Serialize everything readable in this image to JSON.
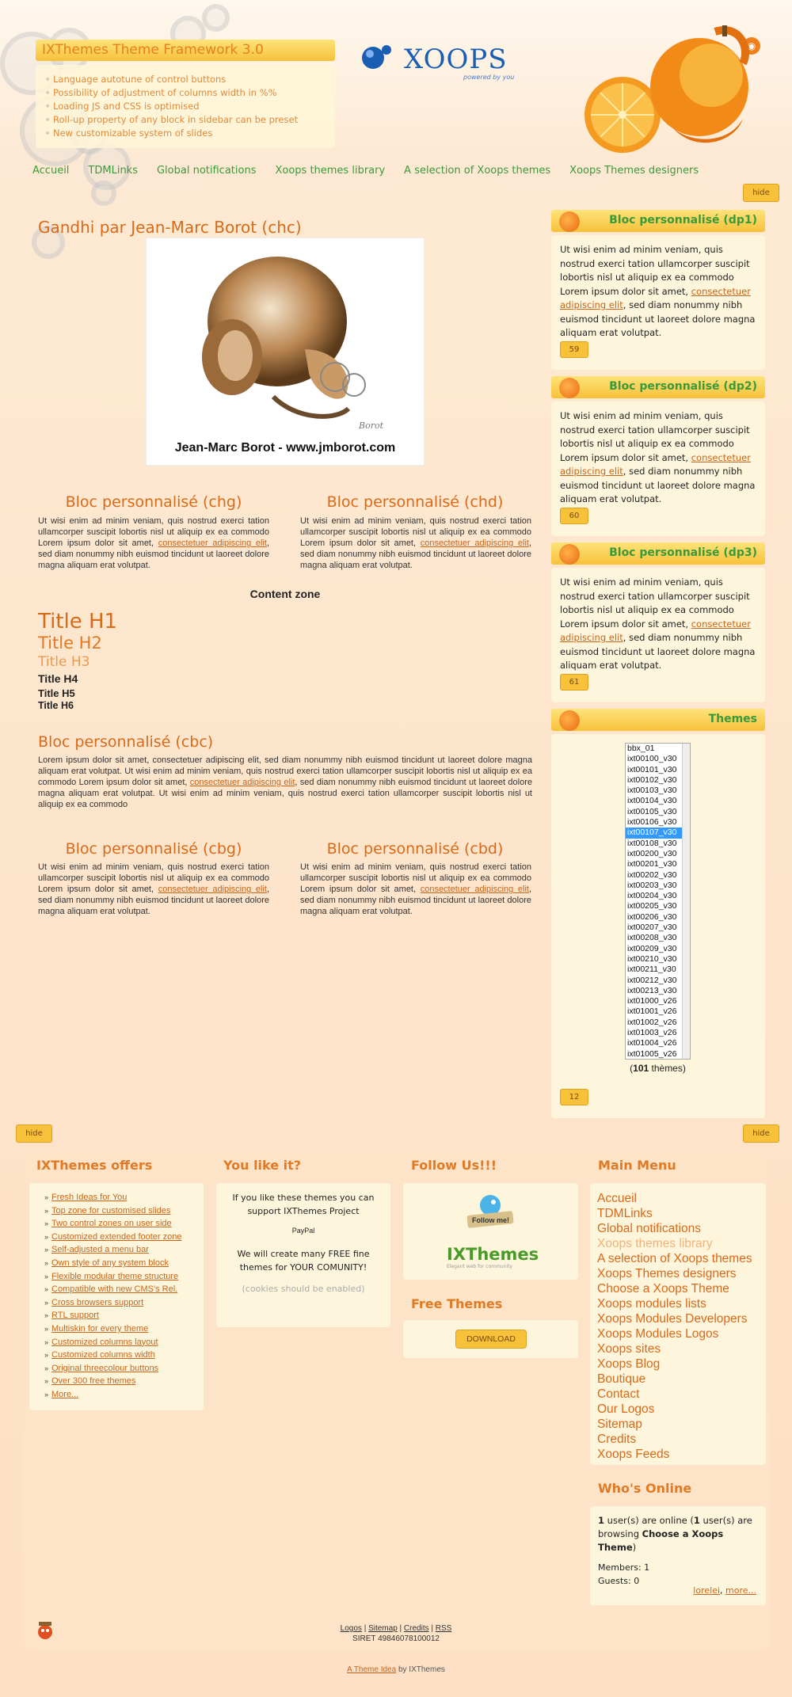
{
  "header": {
    "box_title": "IXThemes Theme Framework 3.0",
    "features": [
      "Language autotune of control buttons",
      "Possibility of adjustment of columns width in %%",
      "Loading JS and CSS is optimised",
      "Roll-up property of any block in sidebar can be preset",
      "New customizable system of slides"
    ],
    "logo_word": "XOOPS",
    "logo_tagline": "powered by you"
  },
  "nav": [
    "Accueil",
    "TDMLinks",
    "Global notifications",
    "Xoops themes library",
    "A selection of Xoops themes",
    "Xoops Themes designers"
  ],
  "hide_label": "hide",
  "main": {
    "title": "Gandhi par Jean-Marc Borot (chc)",
    "image_caption": "Jean-Marc Borot - www.jmborot.com",
    "chg": {
      "title": "Bloc personnalisé (chg)",
      "text": "Ut wisi enim ad minim veniam, quis nostrud exerci tation ullamcorper suscipit lobortis nisl ut aliquip ex ea commodo Lorem ipsum dolor sit amet,",
      "link": "consectetuer adipiscing elit",
      "text2": ", sed diam nonummy nibh euismod tincidunt ut laoreet dolore magna aliquam erat volutpat."
    },
    "chd": {
      "title": "Bloc personnalisé (chd)",
      "text": "Ut wisi enim ad minim veniam, quis nostrud exerci tation ullamcorper suscipit lobortis nisl ut aliquip ex ea commodo Lorem ipsum dolor sit amet,",
      "link": "consectetuer adipiscing elit",
      "text2": ", sed diam nonummy nibh euismod tincidunt ut laoreet dolore magna aliquam erat volutpat."
    },
    "content_zone": "Content zone",
    "headings": [
      "Title H1",
      "Title H2",
      "Title H3",
      "Title H4",
      "Title H5",
      "Title H6"
    ],
    "cbc": {
      "title": "Bloc personnalisé (cbc)",
      "text": "Lorem ipsum dolor sit amet, consectetuer adipiscing elit, sed diam nonummy nibh euismod tincidunt ut laoreet dolore magna aliquam erat volutpat. Ut wisi enim ad minim veniam, quis nostrud exerci tation ullamcorper suscipit lobortis nisl ut aliquip ex ea commodo Lorem ipsum dolor sit amet,",
      "link": "consectetuer adipiscing elit",
      "text2": ", sed diam nonummy nibh euismod tincidunt ut laoreet dolore magna aliquam erat volutpat. Ut wisi enim ad minim veniam, quis nostrud exerci tation ullamcorper suscipit lobortis nisl ut aliquip ex ea commodo"
    },
    "cbg": {
      "title": "Bloc personnalisé (cbg)",
      "text": "Ut wisi enim ad minim veniam, quis nostrud exerci tation ullamcorper suscipit lobortis nisl ut aliquip ex ea commodo Lorem ipsum dolor sit amet,",
      "link": "consectetuer adipiscing elit",
      "text2": ", sed diam nonummy nibh euismod tincidunt ut laoreet dolore magna aliquam erat volutpat."
    },
    "cbd": {
      "title": "Bloc personnalisé (cbd)",
      "text": "Ut wisi enim ad minim veniam, quis nostrud exerci tation ullamcorper suscipit lobortis nisl ut aliquip ex ea commodo Lorem ipsum dolor sit amet,",
      "link": "consectetuer adipiscing elit",
      "text2": ", sed diam nonummy nibh euismod tincidunt ut laoreet dolore magna aliquam erat volutpat."
    }
  },
  "sidebar": {
    "dp1": {
      "title": "Bloc personnalisé (dp1)",
      "text": "Ut wisi enim ad minim veniam, quis nostrud exerci tation ullamcorper suscipit lobortis nisl ut aliquip ex ea commodo Lorem ipsum dolor sit amet,",
      "link": "consectetuer adipiscing elit",
      "text2": ", sed diam nonummy nibh euismod tincidunt ut laoreet dolore magna aliquam erat volutpat.",
      "count": "59"
    },
    "dp2": {
      "title": "Bloc personnalisé (dp2)",
      "text": "Ut wisi enim ad minim veniam, quis nostrud exerci tation ullamcorper suscipit lobortis nisl ut aliquip ex ea commodo Lorem ipsum dolor sit amet,",
      "link": "consectetuer adipiscing elit",
      "text2": ", sed diam nonummy nibh euismod tincidunt ut laoreet dolore magna aliquam erat volutpat.",
      "count": "60"
    },
    "dp3": {
      "title": "Bloc personnalisé (dp3)",
      "text": "Ut wisi enim ad minim veniam, quis nostrud exerci tation ullamcorper suscipit lobortis nisl ut aliquip ex ea commodo Lorem ipsum dolor sit amet,",
      "link": "consectetuer adipiscing elit",
      "text2": ", sed diam nonummy nibh euismod tincidunt ut laoreet dolore magna aliquam erat volutpat.",
      "count": "61"
    },
    "themes": {
      "title": "Themes",
      "options": [
        "bbx_01",
        "ixt00100_v30",
        "ixt00101_v30",
        "ixt00102_v30",
        "ixt00103_v30",
        "ixt00104_v30",
        "ixt00105_v30",
        "ixt00106_v30",
        "ixt00107_v30",
        "ixt00108_v30",
        "ixt00200_v30",
        "ixt00201_v30",
        "ixt00202_v30",
        "ixt00203_v30",
        "ixt00204_v30",
        "ixt00205_v30",
        "ixt00206_v30",
        "ixt00207_v30",
        "ixt00208_v30",
        "ixt00209_v30",
        "ixt00210_v30",
        "ixt00211_v30",
        "ixt00212_v30",
        "ixt00213_v30",
        "ixt01000_v26",
        "ixt01001_v26",
        "ixt01002_v26",
        "ixt01003_v26",
        "ixt01004_v26",
        "ixt01005_v26"
      ],
      "selected": "ixt00107_v30",
      "count_open": "(",
      "count_number": "101",
      "count_suffix": " thèmes)",
      "button": "12"
    }
  },
  "footer": {
    "offers": {
      "title": "IXThemes offers",
      "items": [
        "Fresh Ideas for You",
        "Top zone for customised slides",
        "Two control zones on user side",
        "Customized extended footer zone",
        "Self-adjusted a menu bar",
        "Own style of any system block",
        "Flexible modular theme structure",
        "Compatible with new CMS's Rel.",
        "Cross browsers support",
        "RTL support",
        "Multiskin for every theme",
        "Customized columns layout",
        "Customized columns width",
        "Original threecolour buttons",
        "Over 300 free themes",
        "More..."
      ]
    },
    "like": {
      "title": "You like it?",
      "line1": "If you like these themes you can support IXThemes Project",
      "paypal": "PayPal",
      "line2": "We will create many FREE fine themes for YOUR COMUNITY!",
      "cookies": "(cookies should be enabled)"
    },
    "follow": {
      "title": "Follow Us!!!",
      "followme": "Follow me!",
      "ixthemes": "IXThemes",
      "ixthemes_sub": "Elegant web for community"
    },
    "free": {
      "title": "Free Themes",
      "button": "DOWNLOAD"
    },
    "main_menu": {
      "title": "Main Menu",
      "items": [
        "Accueil",
        "TDMLinks",
        "Global notifications",
        "Xoops themes library",
        "A selection of Xoops themes",
        "Xoops Themes designers",
        "Choose a Xoops Theme",
        "Xoops modules lists",
        "Xoops Modules Developers",
        "Xoops Modules Logos",
        "Xoops sites",
        "Xoops Blog",
        "Boutique",
        "Contact",
        "Our Logos",
        "Sitemap",
        "Credits",
        "Xoops Feeds"
      ],
      "active": "Xoops themes library"
    },
    "online": {
      "title": "Who's Online",
      "users_count": "1",
      "users_text": " user(s) are online (",
      "browsing_count": "1",
      "browsing_text": " user(s) are browsing ",
      "module": "Choose a Xoops Theme",
      "close": ")",
      "members": "Members: 1",
      "guests": "Guests: 0",
      "link_user": "lorelei",
      "link_more": "more..."
    },
    "links": [
      "Logos",
      "Sitemap",
      "Credits",
      "RSS"
    ],
    "siret": "SIRET 49846078100012",
    "credit_link": "A Theme Idea",
    "credit_text": " by IXThemes"
  },
  "colors": {
    "accent": "#d96a18",
    "nav_green": "#3a9a3a",
    "button": "#f7c13a",
    "box_bg": "#fef6dc"
  }
}
